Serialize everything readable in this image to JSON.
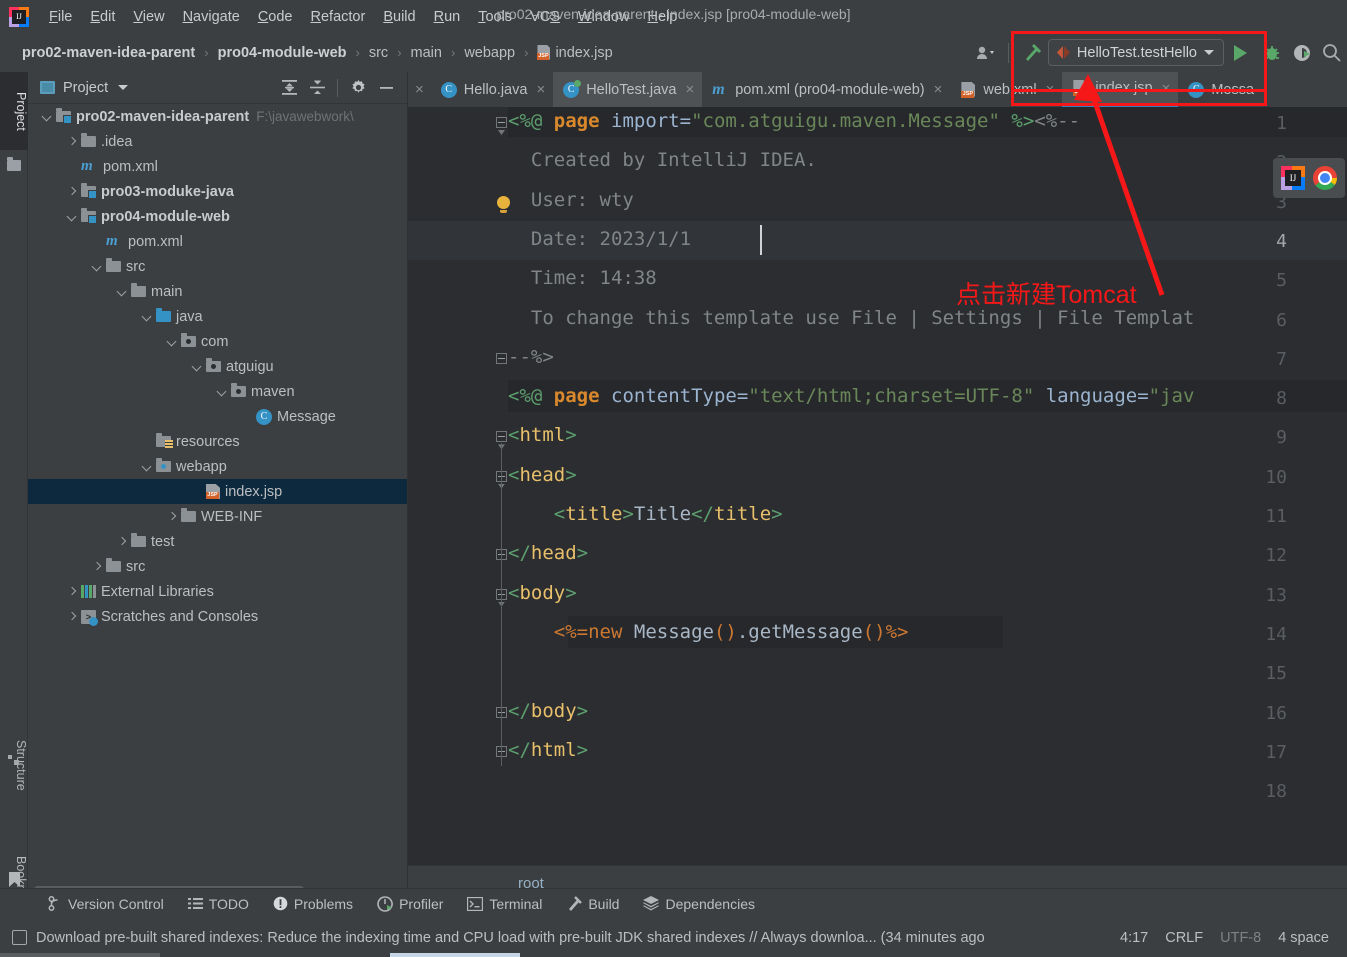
{
  "window": {
    "title": "pro02-maven-idea-parent - index.jsp [pro04-module-web]"
  },
  "menubar": {
    "logo_letters": "IJ",
    "items": [
      {
        "label": "File",
        "mnemonic": "F"
      },
      {
        "label": "Edit",
        "mnemonic": "E"
      },
      {
        "label": "View",
        "mnemonic": "V"
      },
      {
        "label": "Navigate",
        "mnemonic": "N"
      },
      {
        "label": "Code",
        "mnemonic": "C"
      },
      {
        "label": "Refactor",
        "mnemonic": "R"
      },
      {
        "label": "Build",
        "mnemonic": "B"
      },
      {
        "label": "Run",
        "mnemonic": "R"
      },
      {
        "label": "Tools",
        "mnemonic": "T"
      },
      {
        "label": "VCS",
        "mnemonic": "S"
      },
      {
        "label": "Window",
        "mnemonic": "W"
      },
      {
        "label": "Help",
        "mnemonic": "H"
      }
    ]
  },
  "breadcrumb": {
    "items": [
      {
        "label": "pro02-maven-idea-parent",
        "bold": true,
        "icon": ""
      },
      {
        "label": "pro04-module-web",
        "bold": true,
        "icon": ""
      },
      {
        "label": "src",
        "bold": false,
        "icon": ""
      },
      {
        "label": "main",
        "bold": false,
        "icon": ""
      },
      {
        "label": "webapp",
        "bold": false,
        "icon": ""
      },
      {
        "label": "index.jsp",
        "bold": false,
        "icon": "jsp-file-icon"
      }
    ],
    "separator": "›"
  },
  "toolbar": {
    "user_icon": "user-avatar-icon",
    "build_icon": "hammer-icon",
    "run_config_name": "HelloTest.testHello",
    "run_icon": "run-play-icon",
    "debug_icon": "debug-bug-icon",
    "coverage_icon": "run-with-coverage-icon",
    "search_icon": "search-icon"
  },
  "annotation": {
    "text": "点击新建Tomcat",
    "color": "#f61818"
  },
  "left_strip": {
    "tabs": [
      {
        "label": "Project",
        "active": true
      },
      {
        "label": "Structure",
        "active": false
      },
      {
        "label": "Bookmarks",
        "active": false
      }
    ]
  },
  "project_panel": {
    "title": "Project",
    "header_icons": [
      "expand-all-icon",
      "collapse-all-icon",
      "settings-gear-icon",
      "hide-minimize-icon"
    ],
    "tree": [
      {
        "depth": 0,
        "arrow": "down",
        "icon": "module",
        "label": "pro02-maven-idea-parent",
        "bold": true,
        "sub": "F:\\javawebwork\\",
        "selected": false
      },
      {
        "depth": 1,
        "arrow": "right",
        "icon": "folder",
        "label": ".idea",
        "bold": false,
        "sub": "",
        "selected": false
      },
      {
        "depth": 1,
        "arrow": "none",
        "icon": "maven",
        "label": "pom.xml",
        "bold": false,
        "sub": "",
        "selected": false
      },
      {
        "depth": 1,
        "arrow": "right",
        "icon": "module",
        "label": "pro03-moduke-java",
        "bold": true,
        "sub": "",
        "selected": false
      },
      {
        "depth": 1,
        "arrow": "down",
        "icon": "module",
        "label": "pro04-module-web",
        "bold": true,
        "sub": "",
        "selected": false
      },
      {
        "depth": 2,
        "arrow": "none",
        "icon": "maven",
        "label": "pom.xml",
        "bold": false,
        "sub": "",
        "selected": false
      },
      {
        "depth": 2,
        "arrow": "down",
        "icon": "folder",
        "label": "src",
        "bold": false,
        "sub": "",
        "selected": false
      },
      {
        "depth": 3,
        "arrow": "down",
        "icon": "folder",
        "label": "main",
        "bold": false,
        "sub": "",
        "selected": false
      },
      {
        "depth": 4,
        "arrow": "down",
        "icon": "srcfolder",
        "label": "java",
        "bold": false,
        "sub": "",
        "selected": false
      },
      {
        "depth": 5,
        "arrow": "down",
        "icon": "pkg",
        "label": "com",
        "bold": false,
        "sub": "",
        "selected": false
      },
      {
        "depth": 6,
        "arrow": "down",
        "icon": "pkg",
        "label": "atguigu",
        "bold": false,
        "sub": "",
        "selected": false
      },
      {
        "depth": 7,
        "arrow": "down",
        "icon": "pkg",
        "label": "maven",
        "bold": false,
        "sub": "",
        "selected": false
      },
      {
        "depth": 8,
        "arrow": "none",
        "icon": "cls",
        "label": "Message",
        "bold": false,
        "sub": "",
        "selected": false
      },
      {
        "depth": 4,
        "arrow": "none",
        "icon": "res",
        "label": "resources",
        "bold": false,
        "sub": "",
        "selected": false
      },
      {
        "depth": 4,
        "arrow": "down",
        "icon": "webapp",
        "label": "webapp",
        "bold": false,
        "sub": "",
        "selected": false
      },
      {
        "depth": 6,
        "arrow": "none",
        "icon": "jsp",
        "label": "index.jsp",
        "bold": false,
        "sub": "",
        "selected": true
      },
      {
        "depth": 5,
        "arrow": "right",
        "icon": "folder",
        "label": "WEB-INF",
        "bold": false,
        "sub": "",
        "selected": false
      },
      {
        "depth": 3,
        "arrow": "right",
        "icon": "folder",
        "label": "test",
        "bold": false,
        "sub": "",
        "selected": false
      },
      {
        "depth": 2,
        "arrow": "right",
        "icon": "folder",
        "label": "src",
        "bold": false,
        "sub": "",
        "selected": false
      },
      {
        "depth": 1,
        "arrow": "right",
        "icon": "libs",
        "label": "External Libraries",
        "bold": false,
        "sub": "",
        "selected": false
      },
      {
        "depth": 1,
        "arrow": "right",
        "icon": "scratch",
        "label": "Scratches and Consoles",
        "bold": false,
        "sub": "",
        "selected": false
      }
    ]
  },
  "editor": {
    "tabs": [
      {
        "label": "Hello.java",
        "icon": "java-class-icon",
        "state": "normal"
      },
      {
        "label": "HelloTest.java",
        "icon": "java-test-class-icon",
        "state": "active"
      },
      {
        "label": "pom.xml (pro04-module-web)",
        "icon": "maven-icon",
        "state": "normal"
      },
      {
        "label": "web.xml",
        "icon": "xml-file-icon",
        "state": "normal"
      },
      {
        "label": "index.jsp",
        "icon": "jsp-file-icon",
        "state": "current"
      },
      {
        "label": "Messa",
        "icon": "java-class-icon",
        "state": "normal"
      }
    ],
    "breadcrumb_bottom": "root",
    "caret_line": 4,
    "lines": [
      {
        "n": 1,
        "fold": "start",
        "text": "<%@ page import=\"com.atguigu.maven.Message\" %><%--",
        "highlight": true
      },
      {
        "n": 2,
        "fold": "none",
        "text": "  Created by IntelliJ IDEA.",
        "highlight": false
      },
      {
        "n": 3,
        "fold": "none",
        "text": "  User: wty",
        "highlight": false,
        "bulb": true
      },
      {
        "n": 4,
        "fold": "none",
        "text": "  Date: 2023/1/1",
        "highlight": false
      },
      {
        "n": 5,
        "fold": "none",
        "text": "  Time: 14:38",
        "highlight": false
      },
      {
        "n": 6,
        "fold": "none",
        "text": "  To change this template use File | Settings | File Templat",
        "highlight": false
      },
      {
        "n": 7,
        "fold": "end",
        "text": "--%>",
        "highlight": false
      },
      {
        "n": 8,
        "fold": "none",
        "text": "<%@ page contentType=\"text/html;charset=UTF-8\" language=\"jav",
        "highlight": true
      },
      {
        "n": 9,
        "fold": "start",
        "text": "<html>",
        "highlight": false
      },
      {
        "n": 10,
        "fold": "start",
        "text": "<head>",
        "highlight": false
      },
      {
        "n": 11,
        "fold": "none",
        "text": "    <title>Title</title>",
        "highlight": false
      },
      {
        "n": 12,
        "fold": "end",
        "text": "</head>",
        "highlight": false
      },
      {
        "n": 13,
        "fold": "start",
        "text": "<body>",
        "highlight": false
      },
      {
        "n": 14,
        "fold": "none",
        "text": "    <%=new Message().getMessage()%>",
        "highlight": true
      },
      {
        "n": 15,
        "fold": "none",
        "text": "",
        "highlight": false
      },
      {
        "n": 16,
        "fold": "end",
        "text": "</body>",
        "highlight": false
      },
      {
        "n": 17,
        "fold": "end",
        "text": "</html>",
        "highlight": false
      },
      {
        "n": 18,
        "fold": "none",
        "text": "",
        "highlight": false
      }
    ]
  },
  "tool_windows": [
    {
      "label": "Version Control",
      "icon": "branch-icon"
    },
    {
      "label": "TODO",
      "icon": "list-icon"
    },
    {
      "label": "Problems",
      "icon": "exclamation-icon"
    },
    {
      "label": "Profiler",
      "icon": "profiler-icon"
    },
    {
      "label": "Terminal",
      "icon": "terminal-icon"
    },
    {
      "label": "Build",
      "icon": "hammer-icon"
    },
    {
      "label": "Dependencies",
      "icon": "layers-icon"
    }
  ],
  "status_bar": {
    "icon": "notification-icon",
    "message": "Download pre-built shared indexes: Reduce the indexing time and CPU load with pre-built JDK shared indexes // Always downloa... (34 minutes ago",
    "caret_position": "4:17",
    "line_separator": "CRLF",
    "encoding": "UTF-8",
    "indent": "4 space"
  }
}
